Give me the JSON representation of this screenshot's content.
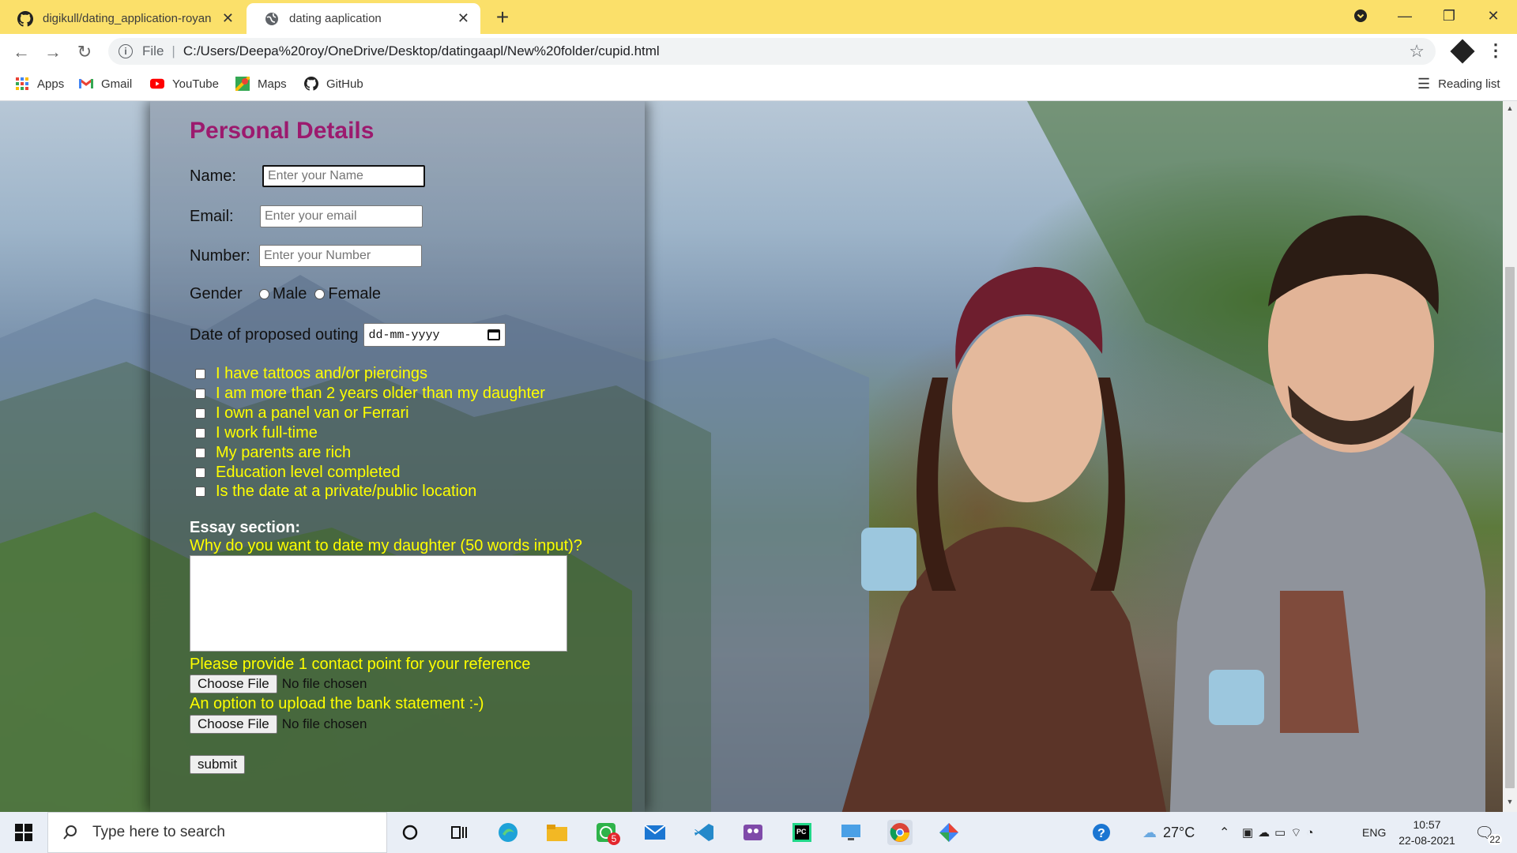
{
  "browser": {
    "tabs": [
      {
        "title": "digikull/dating_application-royan"
      },
      {
        "title": "dating aaplication"
      }
    ],
    "new_tab": "+",
    "url_scheme": "File",
    "url_path": "C:/Users/Deepa%20roy/OneDrive/Desktop/datingaapl/New%20folder/cupid.html",
    "bookmarks": [
      "Apps",
      "Gmail",
      "YouTube",
      "Maps",
      "GitHub"
    ],
    "reading_list": "Reading list"
  },
  "form": {
    "title": "Personal Details",
    "name_label": "Name:",
    "name_placeholder": "Enter your Name",
    "email_label": "Email:",
    "email_placeholder": "Enter your email",
    "number_label": "Number:",
    "number_placeholder": "Enter your Number",
    "gender_label": "Gender",
    "gender_options": [
      "Male",
      "Female"
    ],
    "date_label": "Date of proposed outing",
    "date_placeholder": "dd-mm-yyyy",
    "checkboxes": [
      "I have tattoos and/or piercings",
      "I am more than 2 years older than my daughter",
      "I own a panel van or Ferrari",
      "I work full-time",
      "My parents are rich",
      "Education level completed",
      "Is the date at a private/public location"
    ],
    "essay_heading": "Essay section:",
    "essay_question": "Why do you want to date my daughter (50 words input)?",
    "reference_label": "Please provide 1 contact point for your reference",
    "choose_file": "Choose File",
    "no_file": "No file chosen",
    "bank_label": "An option to upload the bank statement :-)",
    "submit": "submit"
  },
  "taskbar": {
    "search_placeholder": "Type here to search",
    "whatsapp_badge": "5",
    "temperature": "27°C",
    "language": "ENG",
    "time": "10:57",
    "date": "22-08-2021",
    "notifications": "22"
  },
  "colors": {
    "tab_strip": "#fbe06a",
    "heading": "#9c1a6e",
    "question_text": "#ffff00"
  }
}
